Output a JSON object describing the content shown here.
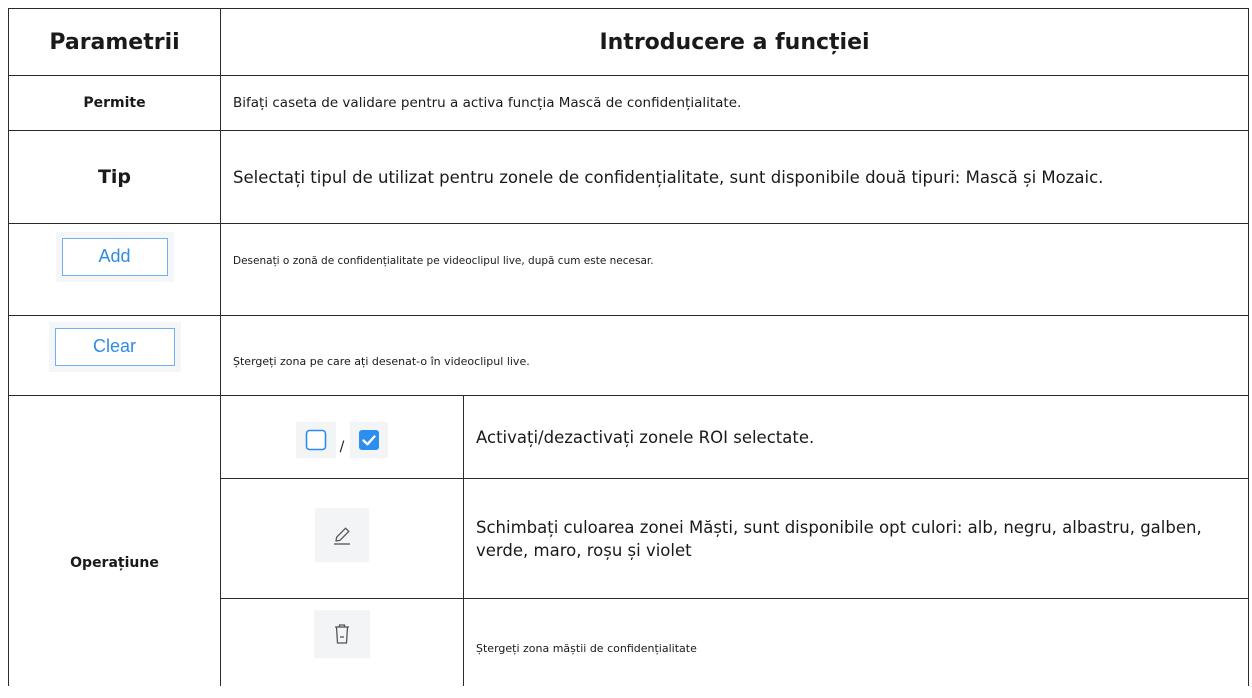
{
  "header": {
    "col1": "Parametrii",
    "col2": "Introducere a funcției"
  },
  "rows": [
    {
      "param": "Permite",
      "desc": "Bifați caseta de validare pentru a activa funcția Mască de confidențialitate."
    },
    {
      "param": "Tip",
      "desc": "Selectați tipul de utilizat pentru zonele de confidențialitate, sunt disponibile două tipuri: Mască și Mozaic."
    },
    {
      "button_label": "Add",
      "desc": "Desenați o zonă de confidențialitate pe videoclipul live, după cum este necesar."
    },
    {
      "button_label": "Clear",
      "desc": "Ștergeți zona pe care ați desenat-o în videoclipul live."
    }
  ],
  "operation": {
    "param": "Operațiune",
    "items": [
      {
        "icons": [
          "checkbox-unchecked-icon",
          "checkbox-checked-icon"
        ],
        "separator": "/",
        "desc": "Activați/dezactivați zonele ROI selectate."
      },
      {
        "icon": "pencil-icon",
        "desc": "Schimbați culoarea zonei Măști, sunt disponibile opt culori: alb, negru, albastru, galben, verde, maro, roșu și violet"
      },
      {
        "icon": "trash-icon",
        "desc": "Ștergeți zona măștii de confidențialitate"
      }
    ]
  },
  "colors": {
    "border": "#2b2b2b",
    "button_text": "#2f8be6",
    "button_border": "#6fb1f3",
    "checkbox_checked": "#2d8ef0"
  }
}
